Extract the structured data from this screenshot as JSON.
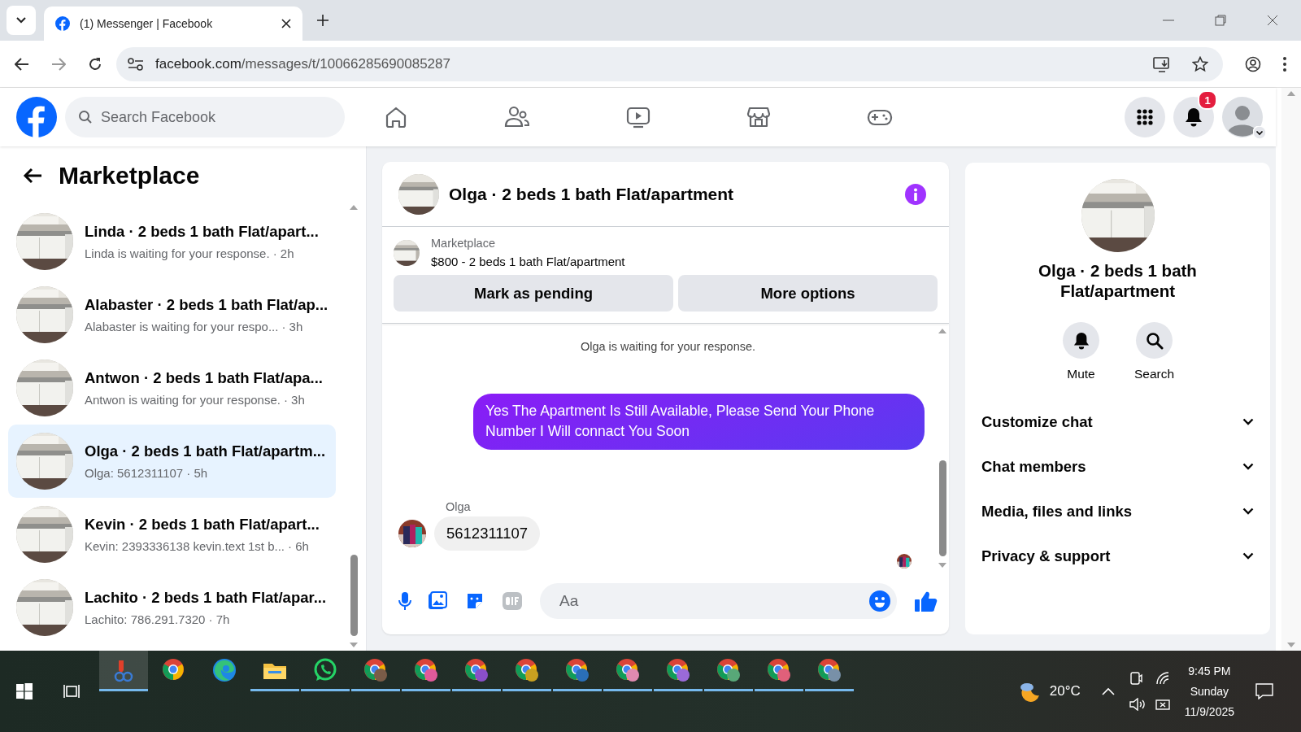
{
  "browser": {
    "tab_title": "(1) Messenger | Facebook",
    "url_host": "facebook.com",
    "url_path": "/messages/t/10066285690085287"
  },
  "header": {
    "search": {
      "placeholder": "Search Facebook"
    },
    "notification_count": "1"
  },
  "sidebar": {
    "title": "Marketplace",
    "conversations": [
      {
        "title": "Linda · 2 beds 1 bath Flat/apart...",
        "preview": "Linda is waiting for your response.",
        "time": "· 2h",
        "selected": false
      },
      {
        "title": "Alabaster · 2 beds 1 bath Flat/ap...",
        "preview": "Alabaster is waiting for your respo...",
        "time": "· 3h",
        "selected": false
      },
      {
        "title": "Antwon · 2 beds 1 bath Flat/apa...",
        "preview": "Antwon is waiting for your response.",
        "time": "· 3h",
        "selected": false
      },
      {
        "title": "Olga · 2 beds 1 bath Flat/apartm...",
        "preview": "Olga: 5612311107",
        "time": "· 5h",
        "selected": true
      },
      {
        "title": "Kevin · 2 beds 1 bath Flat/apart...",
        "preview": "Kevin: 2393336138 kevin.text 1st b...",
        "time": "· 6h",
        "selected": false
      },
      {
        "title": "Lachito · 2 beds 1 bath Flat/apar...",
        "preview": "Lachito: 786.291.7320",
        "time": "· 7h",
        "selected": false
      }
    ]
  },
  "chat": {
    "title": "Olga · 2 beds 1 bath Flat/apartment",
    "listing": {
      "source": "Marketplace",
      "summary": "$800 - 2 beds 1 bath Flat/apartment"
    },
    "buttons": [
      "Mark as pending",
      "More options"
    ],
    "system_note": "Olga is waiting for your response.",
    "messages": [
      {
        "kind": "outgoing",
        "text": "Yes The Apartment Is Still Available, Please Send Your Phone Number I Will connact You Soon"
      },
      {
        "kind": "incoming",
        "sender": "Olga",
        "text": "5612311107"
      }
    ],
    "composer": {
      "placeholder": "Aa"
    }
  },
  "details": {
    "title": "Olga · 2 beds 1 bath Flat/apartment",
    "actions": [
      {
        "kind": "mute",
        "label": "Mute"
      },
      {
        "kind": "search",
        "label": "Search"
      }
    ],
    "sections": [
      {
        "label": "Customize chat",
        "expanded": false
      },
      {
        "label": "Chat members",
        "expanded": false
      },
      {
        "label": "Media, files and links",
        "expanded": false
      },
      {
        "label": "Privacy & support",
        "expanded": false
      }
    ]
  },
  "taskbar": {
    "apps": [
      {
        "kind": "tool",
        "running": true,
        "selected": true
      },
      {
        "kind": "chrome",
        "running": false,
        "selected": false
      },
      {
        "kind": "edge",
        "running": false,
        "selected": false
      },
      {
        "kind": "folder",
        "running": true,
        "selected": false
      },
      {
        "kind": "whatsapp",
        "running": true,
        "selected": false
      },
      {
        "kind": "profile",
        "color": "#7a5c48",
        "running": true,
        "selected": false
      },
      {
        "kind": "profile",
        "color": "#e05a9a",
        "running": true,
        "selected": false
      },
      {
        "kind": "profile",
        "color": "#8a4fc8",
        "running": true,
        "selected": false
      },
      {
        "kind": "profile",
        "color": "#c8a020",
        "running": true,
        "selected": false
      },
      {
        "kind": "profile",
        "color": "#2a6fb8",
        "running": true,
        "selected": false
      },
      {
        "kind": "profile",
        "color": "#e08ab0",
        "running": true,
        "selected": false
      },
      {
        "kind": "profile",
        "color": "#9a6ad8",
        "running": true,
        "selected": false
      },
      {
        "kind": "profile",
        "color": "#58a878",
        "running": true,
        "selected": false
      },
      {
        "kind": "profile",
        "color": "#e0607a",
        "running": true,
        "selected": false
      },
      {
        "kind": "profile",
        "color": "#7890a8",
        "running": true,
        "selected": false
      }
    ],
    "temperature": "20°C",
    "time": "9:45 PM",
    "day": "Sunday",
    "date": "11/9/2025"
  }
}
